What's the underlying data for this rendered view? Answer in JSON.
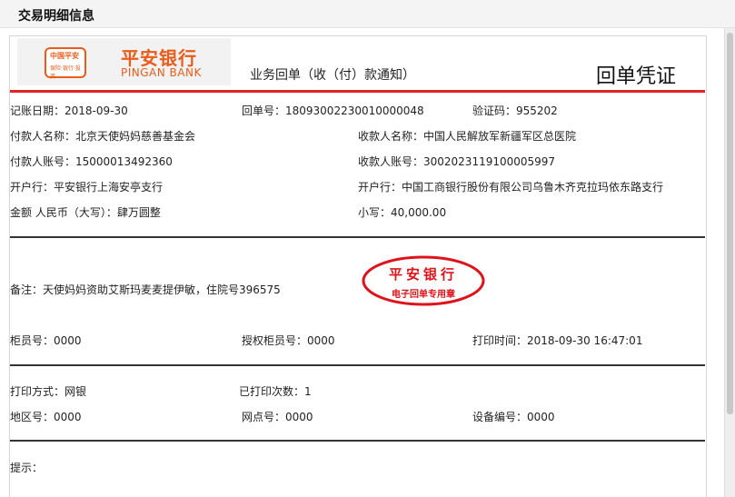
{
  "window": {
    "title": "交易明细信息"
  },
  "bank": {
    "logo_badge_name": "中国平安",
    "logo_badge_sub": "保险·银行·投资",
    "name_cn": "平安银行",
    "name_en": "PINGAN BANK"
  },
  "header": {
    "notice": "业务回单（收（付）款通知）",
    "voucher": "回单凭证"
  },
  "fields": {
    "account_date": "记账日期：2018-09-30",
    "receipt_no": "回单号：18093002230010000048",
    "verify_code": "验证码：955202",
    "payer_name": "付款人名称：北京天使妈妈慈善基金会",
    "payee_name": "收款人名称：中国人民解放军新疆军区总医院",
    "payer_account": "付款人账号：15000013492360",
    "payee_account": "收款人账号：3002023119100005997",
    "payer_bank": "开户行：平安银行上海安亭支行",
    "payee_bank": "开户行：中国工商银行股份有限公司乌鲁木齐克拉玛依东路支行",
    "amount_upper": "金额 人民币（大写）：肆万圆整",
    "amount_lower": "小写：40,000.00",
    "remark": "备注：天使妈妈资助艾斯玛麦麦提伊敏，住院号396575",
    "teller_no": "柜员号：0000",
    "auth_teller_no": "授权柜员号：0000",
    "print_time": "打印时间：2018-09-30 16:47:01",
    "print_method": "打印方式：网银",
    "print_count": "已打印次数：1",
    "area_no": "地区号：0000",
    "branch_no": "网点号：0000",
    "device_no": "设备编号：0000",
    "tips": "提示："
  },
  "stamp": {
    "top": "平安银行",
    "bottom": "电子回单专用章",
    "color": "#e0121a"
  },
  "colors": {
    "brand": "#e95c1a",
    "accent_line": "#e22424"
  }
}
